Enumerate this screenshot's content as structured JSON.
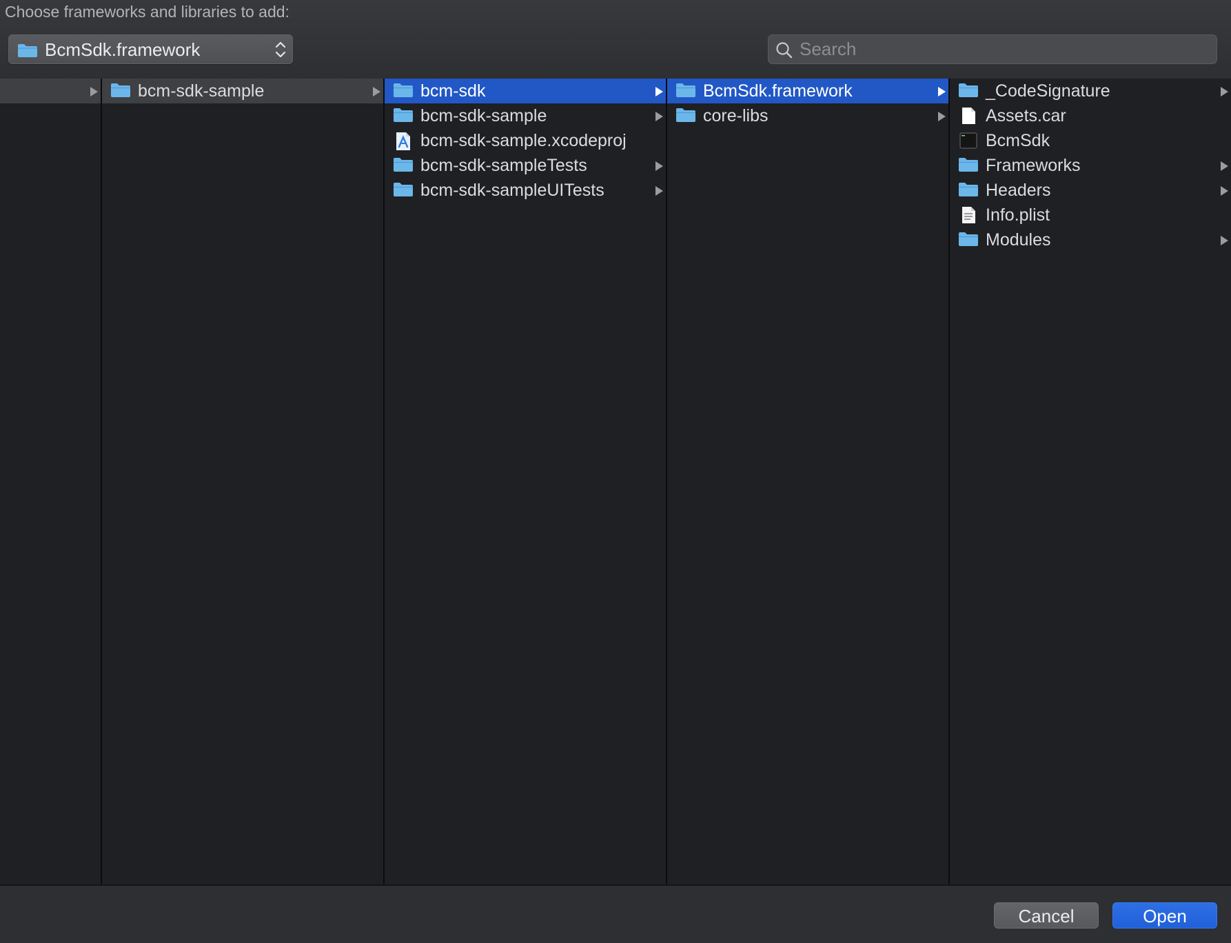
{
  "dialog": {
    "prompt": "Choose frameworks and libraries to add:",
    "location": "BcmSdk.framework",
    "search_placeholder": "Search"
  },
  "columns": [
    {
      "items": [
        {
          "name": "",
          "kind": "folder",
          "has_children": true,
          "state": "path"
        }
      ]
    },
    {
      "items": [
        {
          "name": "bcm-sdk-sample",
          "kind": "folder",
          "has_children": true,
          "state": "path"
        }
      ]
    },
    {
      "items": [
        {
          "name": "bcm-sdk",
          "kind": "folder",
          "has_children": true,
          "state": "selected"
        },
        {
          "name": "bcm-sdk-sample",
          "kind": "folder",
          "has_children": true,
          "state": ""
        },
        {
          "name": "bcm-sdk-sample.xcodeproj",
          "kind": "xcodeproj",
          "has_children": false,
          "state": ""
        },
        {
          "name": "bcm-sdk-sampleTests",
          "kind": "folder",
          "has_children": true,
          "state": ""
        },
        {
          "name": "bcm-sdk-sampleUITests",
          "kind": "folder",
          "has_children": true,
          "state": ""
        }
      ]
    },
    {
      "items": [
        {
          "name": "BcmSdk.framework",
          "kind": "folder",
          "has_children": true,
          "state": "selected"
        },
        {
          "name": "core-libs",
          "kind": "folder",
          "has_children": true,
          "state": ""
        }
      ]
    },
    {
      "items": [
        {
          "name": "_CodeSignature",
          "kind": "folder",
          "has_children": true,
          "state": ""
        },
        {
          "name": "Assets.car",
          "kind": "document",
          "has_children": false,
          "state": ""
        },
        {
          "name": "BcmSdk",
          "kind": "executable",
          "has_children": false,
          "state": ""
        },
        {
          "name": "Frameworks",
          "kind": "folder",
          "has_children": true,
          "state": ""
        },
        {
          "name": "Headers",
          "kind": "folder",
          "has_children": true,
          "state": ""
        },
        {
          "name": "Info.plist",
          "kind": "plist",
          "has_children": false,
          "state": ""
        },
        {
          "name": "Modules",
          "kind": "folder",
          "has_children": true,
          "state": ""
        }
      ]
    }
  ],
  "buttons": {
    "cancel": "Cancel",
    "open": "Open"
  },
  "colors": {
    "selection": "#2158c6",
    "folder": "#6cb7ea",
    "background": "#1f2023"
  }
}
